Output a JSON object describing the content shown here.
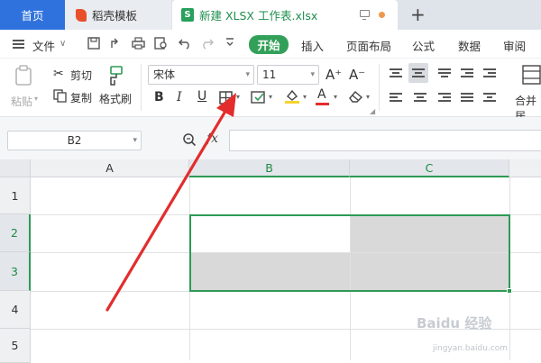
{
  "tabs": {
    "home": "首页",
    "daoke": "稻壳模板",
    "file": "新建 XLSX 工作表.xlsx",
    "file_logo": "S",
    "new_tab": "+"
  },
  "menu": {
    "file": "文件",
    "file_caret": "∨",
    "items": [
      "开始",
      "插入",
      "页面布局",
      "公式",
      "数据",
      "审阅"
    ]
  },
  "ribbon": {
    "paste": "粘贴",
    "cut": "剪切",
    "copy": "复制",
    "format_painter": "格式刷",
    "font_name": "宋体",
    "font_size": "11",
    "bold": "B",
    "italic": "I",
    "underline": "U",
    "font_color_letter": "A",
    "grow_font": "A⁺",
    "shrink_font": "A⁻",
    "merge_center": "合并居"
  },
  "formula_bar": {
    "name_box": "B2",
    "fx": "fx",
    "formula": ""
  },
  "grid": {
    "columns": [
      "A",
      "B",
      "C"
    ],
    "rows": [
      "1",
      "2",
      "3",
      "4",
      "5"
    ],
    "active_columns": [
      "B",
      "C"
    ],
    "active_rows": [
      "2",
      "3"
    ]
  },
  "watermark": {
    "text": "Baidu 经验",
    "sub": "jingyan.baidu.com"
  },
  "colors": {
    "accent_green": "#2e9a55",
    "tab_blue": "#2f72dd",
    "arrow_red": "#e32d2d",
    "selection_gray": "#d9d9d9"
  }
}
